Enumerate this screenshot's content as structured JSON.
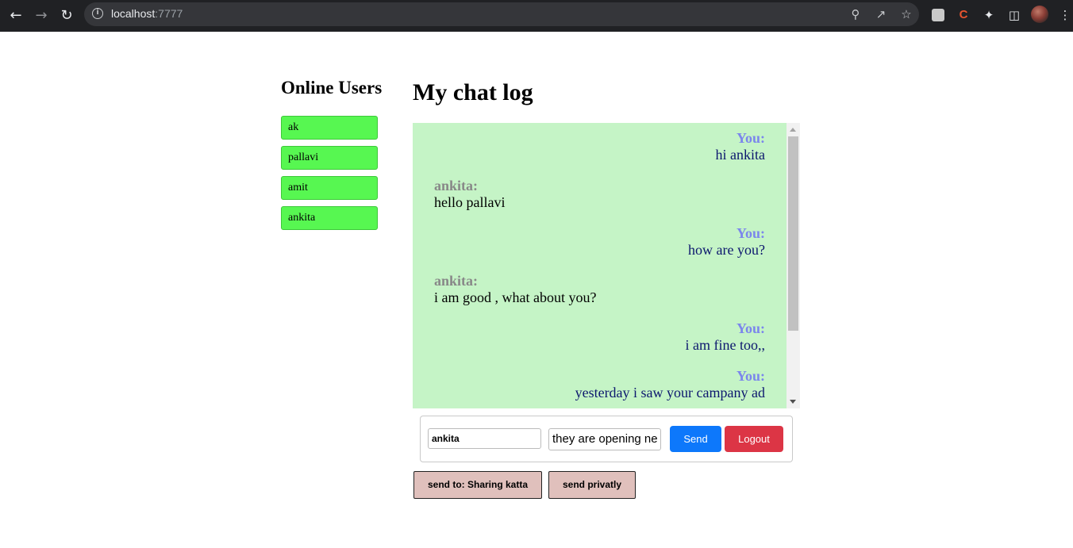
{
  "browser": {
    "url_host": "localhost",
    "url_port": ":7777",
    "icons": [
      "back-icon",
      "forward-icon",
      "reload-icon",
      "info-icon",
      "zoom-icon",
      "share-icon",
      "star-icon",
      "extension-icon",
      "puzzle-icon",
      "sidepanel-icon",
      "menu-icon"
    ]
  },
  "sidebar": {
    "title": "Online Users",
    "users": [
      {
        "name": "ak"
      },
      {
        "name": "pallavi"
      },
      {
        "name": "amit"
      },
      {
        "name": "ankita"
      }
    ],
    "user_color": "#57f751"
  },
  "chat": {
    "title": "My chat log",
    "background": "#c5f4c6",
    "messages": [
      {
        "sender": "You:",
        "text": "hi ankita",
        "mine": true
      },
      {
        "sender": "ankita:",
        "text": "hello pallavi",
        "mine": false
      },
      {
        "sender": "You:",
        "text": "how are you?",
        "mine": true
      },
      {
        "sender": "ankita:",
        "text": "i am good , what about you?",
        "mine": false
      },
      {
        "sender": "You:",
        "text": "i am fine too,,",
        "mine": true
      },
      {
        "sender": "You:",
        "text": "yesterday i saw your campany ad",
        "mine": true
      }
    ]
  },
  "composer": {
    "to_value": "ankita",
    "message_value": "they are opening ne",
    "send_label": "Send",
    "logout_label": "Logout",
    "send_color": "#0d78fb",
    "logout_color": "#dc3545"
  },
  "actions": {
    "send_to_label": "send to: Sharing katta",
    "send_private_label": "send privatly"
  }
}
